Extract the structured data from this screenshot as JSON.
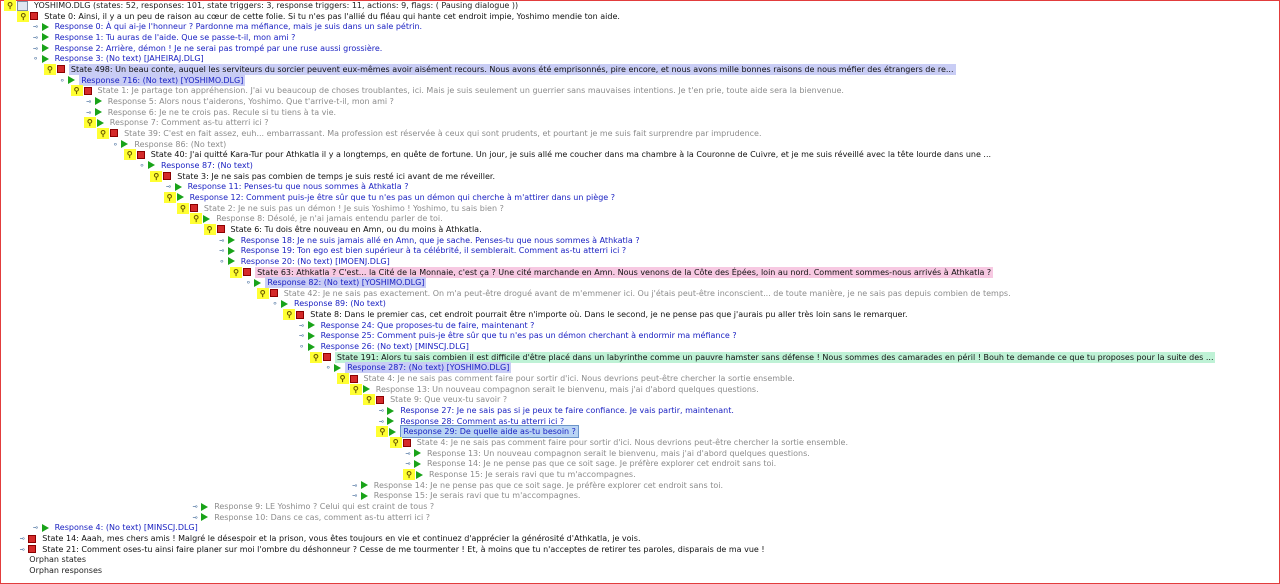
{
  "rows": [
    {
      "indent": 0,
      "handle": "key",
      "icon": "file",
      "text": "YOSHIMO.DLG (states: 52, responses: 101, state triggers: 3, response triggers: 11, actions: 9, flags: ( Pausing dialogue ))",
      "style": "plain"
    },
    {
      "indent": 1,
      "handle": "key",
      "icon": "state",
      "text": "State 0: Ainsi, il y a un peu de raison au cœur de cette folie. Si tu n'es pas l'allié du fléau qui hante cet endroit impie, Yoshimo mendie ton aide.",
      "style": "state"
    },
    {
      "indent": 2,
      "handle": "leaf",
      "icon": "resp",
      "text": "Response 0: À qui ai-je l'honneur ? Pardonne ma méfiance, mais je suis dans un sale pétrin.",
      "style": "resp"
    },
    {
      "indent": 2,
      "handle": "leaf",
      "icon": "resp",
      "text": "Response 1: Tu auras de l'aide. Que se passe-t-il, mon ami ?",
      "style": "resp"
    },
    {
      "indent": 2,
      "handle": "leaf",
      "icon": "resp",
      "text": "Response 2: Arrière, démon ! Je ne serai pas trompé par une ruse aussi grossière.",
      "style": "resp"
    },
    {
      "indent": 2,
      "handle": "open",
      "icon": "resp",
      "text": "Response 3: (No text) [JAHEIRAJ.DLG]",
      "style": "resp"
    },
    {
      "indent": 3,
      "handle": "key",
      "icon": "state",
      "text": "State 498: Un beau conte, auquel les serviteurs du sorcier peuvent eux-mêmes avoir aisément recours. Nous avons été emprisonnés, pire encore, et nous avons mille bonnes raisons de nous méfier des étrangers de re...",
      "style": "state-blue"
    },
    {
      "indent": 4,
      "handle": "open",
      "icon": "resp",
      "text": "Response 716: (No text) [YOSHIMO.DLG]",
      "style": "resp-blue"
    },
    {
      "indent": 5,
      "handle": "key",
      "icon": "state",
      "text": "State 1: Je partage ton appréhension. J'ai vu beaucoup de choses troublantes, ici. Mais je suis seulement un guerrier sans mauvaises intentions. Je t'en prie, toute aide sera la bienvenue.",
      "style": "gray"
    },
    {
      "indent": 6,
      "handle": "leaf",
      "icon": "resp",
      "text": "Response 5: Alors nous t'aiderons, Yoshimo. Que t'arrive-t-il, mon ami ?",
      "style": "gray"
    },
    {
      "indent": 6,
      "handle": "leaf",
      "icon": "resp",
      "text": "Response 6: Je ne te crois pas. Recule si tu tiens à ta vie.",
      "style": "gray"
    },
    {
      "indent": 6,
      "handle": "key",
      "icon": "resp",
      "text": "Response 7: Comment as-tu atterri ici ?",
      "style": "gray"
    },
    {
      "indent": 7,
      "handle": "key",
      "icon": "state",
      "text": "State 39: C'est en fait assez, euh... embarrassant. Ma profession est réservée à ceux qui sont prudents, et pourtant je me suis fait surprendre par imprudence.",
      "style": "gray"
    },
    {
      "indent": 8,
      "handle": "open",
      "icon": "resp",
      "text": "Response 86: (No text)",
      "style": "gray"
    },
    {
      "indent": 9,
      "handle": "key",
      "icon": "state",
      "text": "State 40: J'ai quitté Kara-Tur pour Athkatla il y a longtemps, en quête de fortune. Un jour, je suis allé me coucher dans ma chambre à la Couronne de Cuivre, et je me suis réveillé avec la tête lourde dans une ...",
      "style": "state"
    },
    {
      "indent": 10,
      "handle": "open",
      "icon": "resp",
      "text": "Response 87: (No text)",
      "style": "resp"
    },
    {
      "indent": 11,
      "handle": "key",
      "icon": "state",
      "text": "State 3: Je ne sais pas combien de temps je suis resté ici avant de me réveiller.",
      "style": "state"
    },
    {
      "indent": 12,
      "handle": "leaf",
      "icon": "resp",
      "text": "Response 11: Penses-tu que nous sommes à Athkatla ?",
      "style": "resp"
    },
    {
      "indent": 12,
      "handle": "key",
      "icon": "resp",
      "text": "Response 12: Comment puis-je être sûr que tu n'es pas un démon qui cherche à m'attirer dans un piège ?",
      "style": "resp"
    },
    {
      "indent": 13,
      "handle": "key",
      "icon": "state",
      "text": "State 2: Je ne suis pas un démon ! Je suis Yoshimo ! Yoshimo, tu sais bien ?",
      "style": "gray"
    },
    {
      "indent": 14,
      "handle": "key",
      "icon": "resp",
      "text": "Response 8: Désolé, je n'ai jamais entendu parler de toi.",
      "style": "gray"
    },
    {
      "indent": 15,
      "handle": "key",
      "icon": "state",
      "text": "State 6: Tu dois être nouveau en Amn, ou du moins à Athkatla.",
      "style": "state"
    },
    {
      "indent": 16,
      "handle": "leaf",
      "icon": "resp",
      "text": "Response 18: Je ne suis jamais allé en Amn, que je sache. Penses-tu que nous sommes à Athkatla ?",
      "style": "resp"
    },
    {
      "indent": 16,
      "handle": "leaf",
      "icon": "resp",
      "text": "Response 19: Ton ego est bien supérieur à ta célébrité, il semblerait. Comment as-tu atterri ici ?",
      "style": "resp"
    },
    {
      "indent": 16,
      "handle": "open",
      "icon": "resp",
      "text": "Response 20: (No text) [IMOENJ.DLG]",
      "style": "resp"
    },
    {
      "indent": 17,
      "handle": "key",
      "icon": "state",
      "text": "State 63: Athkatla ? C'est... la Cité de la Monnaie, c'est ça ? Une cité marchande en Amn. Nous venons de la Côte des Épées, loin au nord. Comment sommes-nous arrivés à Athkatla ?",
      "style": "state-pink"
    },
    {
      "indent": 18,
      "handle": "open",
      "icon": "resp",
      "text": "Response 82: (No text) [YOSHIMO.DLG]",
      "style": "resp-blue"
    },
    {
      "indent": 19,
      "handle": "key",
      "icon": "state",
      "text": "State 42: Je ne sais pas exactement. On m'a peut-être drogué avant de m'emmener ici. Ou j'étais peut-être inconscient... de toute manière, je ne sais pas depuis combien de temps.",
      "style": "gray"
    },
    {
      "indent": 20,
      "handle": "open",
      "icon": "resp",
      "text": "Response 89: (No text)",
      "style": "resp"
    },
    {
      "indent": 21,
      "handle": "key",
      "icon": "state",
      "text": "State 8: Dans le premier cas, cet endroit pourrait être n'importe où. Dans le second, je ne pense pas que j'aurais pu aller très loin sans le remarquer.",
      "style": "state"
    },
    {
      "indent": 22,
      "handle": "leaf",
      "icon": "resp",
      "text": "Response 24: Que proposes-tu de faire, maintenant ?",
      "style": "resp"
    },
    {
      "indent": 22,
      "handle": "leaf",
      "icon": "resp",
      "text": "Response 25: Comment puis-je être sûr que tu n'es pas un démon cherchant à endormir ma méfiance ?",
      "style": "resp"
    },
    {
      "indent": 22,
      "handle": "open",
      "icon": "resp",
      "text": "Response 26: (No text) [MINSCJ.DLG]",
      "style": "resp"
    },
    {
      "indent": 23,
      "handle": "key",
      "icon": "state",
      "text": "State 191: Alors tu sais combien il est difficile d'être placé dans un labyrinthe comme un pauvre hamster sans défense ! Nous sommes des camarades en péril ! Bouh te demande ce que tu proposes pour la suite des ...",
      "style": "state-green"
    },
    {
      "indent": 24,
      "handle": "open",
      "icon": "resp",
      "text": "Response 287: (No text) [YOSHIMO.DLG]",
      "style": "resp-blue"
    },
    {
      "indent": 25,
      "handle": "key",
      "icon": "state",
      "text": "State 4: Je ne sais pas comment faire pour sortir d'ici. Nous devrions peut-être chercher la sortie ensemble.",
      "style": "gray"
    },
    {
      "indent": 26,
      "handle": "key",
      "icon": "resp",
      "text": "Response 13: Un nouveau compagnon serait le bienvenu, mais j'ai d'abord quelques questions.",
      "style": "gray"
    },
    {
      "indent": 27,
      "handle": "key",
      "icon": "state",
      "text": "State 9: Que veux-tu savoir ?",
      "style": "gray"
    },
    {
      "indent": 28,
      "handle": "leaf",
      "icon": "resp",
      "text": "Response 27: Je ne sais pas si je peux te faire confiance. Je vais partir, maintenant.",
      "style": "resp"
    },
    {
      "indent": 28,
      "handle": "leaf",
      "icon": "resp",
      "text": "Response 28: Comment as-tu atterri ici ?",
      "style": "resp"
    },
    {
      "indent": 28,
      "handle": "key",
      "icon": "resp",
      "text": "Response 29: De quelle aide as-tu besoin ?",
      "style": "resp-sel"
    },
    {
      "indent": 29,
      "handle": "key",
      "icon": "state",
      "text": "State 4: Je ne sais pas comment faire pour sortir d'ici. Nous devrions peut-être chercher la sortie ensemble.",
      "style": "gray"
    },
    {
      "indent": 30,
      "handle": "leaf",
      "icon": "resp",
      "text": "Response 13: Un nouveau compagnon serait le bienvenu, mais j'ai d'abord quelques questions.",
      "style": "gray"
    },
    {
      "indent": 30,
      "handle": "leaf",
      "icon": "resp",
      "text": "Response 14: Je ne pense pas que ce soit sage. Je préfère explorer cet endroit sans toi.",
      "style": "gray"
    },
    {
      "indent": 30,
      "handle": "key",
      "icon": "resp",
      "text": "Response 15: Je serais ravi que tu m'accompagnes.",
      "style": "gray"
    },
    {
      "indent": 26,
      "handle": "leaf",
      "icon": "resp",
      "text": "Response 14: Je ne pense pas que ce soit sage. Je préfère explorer cet endroit sans toi.",
      "style": "gray"
    },
    {
      "indent": 26,
      "handle": "leaf",
      "icon": "resp",
      "text": "Response 15: Je serais ravi que tu m'accompagnes.",
      "style": "gray"
    },
    {
      "indent": 14,
      "handle": "leaf",
      "icon": "resp",
      "text": "Response 9: LE Yoshimo ? Celui qui est craint de tous ?",
      "style": "gray"
    },
    {
      "indent": 14,
      "handle": "leaf",
      "icon": "resp",
      "text": "Response 10: Dans ce cas, comment as-tu atterri ici ?",
      "style": "gray"
    },
    {
      "indent": 2,
      "handle": "leaf",
      "icon": "resp",
      "text": "Response 4: (No text) [MINSCJ.DLG]",
      "style": "resp"
    },
    {
      "indent": 1,
      "handle": "leaf",
      "icon": "state",
      "text": "State 14: Aaah, mes chers amis ! Malgré le désespoir et la prison, vous êtes toujours en vie et continuez d'apprécier la générosité d'Athkatla, je vois.",
      "style": "state"
    },
    {
      "indent": 1,
      "handle": "leaf",
      "icon": "state",
      "text": "State 21: Comment oses-tu ainsi faire planer sur moi l'ombre du déshonneur ? Cesse de me tourmenter ! Et, à moins que tu n'acceptes de retirer tes paroles, disparais de ma vue !",
      "style": "state"
    },
    {
      "indent": 1,
      "handle": "none",
      "icon": "none",
      "text": "Orphan states",
      "style": "plain"
    },
    {
      "indent": 1,
      "handle": "none",
      "icon": "none",
      "text": "Orphan responses",
      "style": "plain"
    }
  ]
}
